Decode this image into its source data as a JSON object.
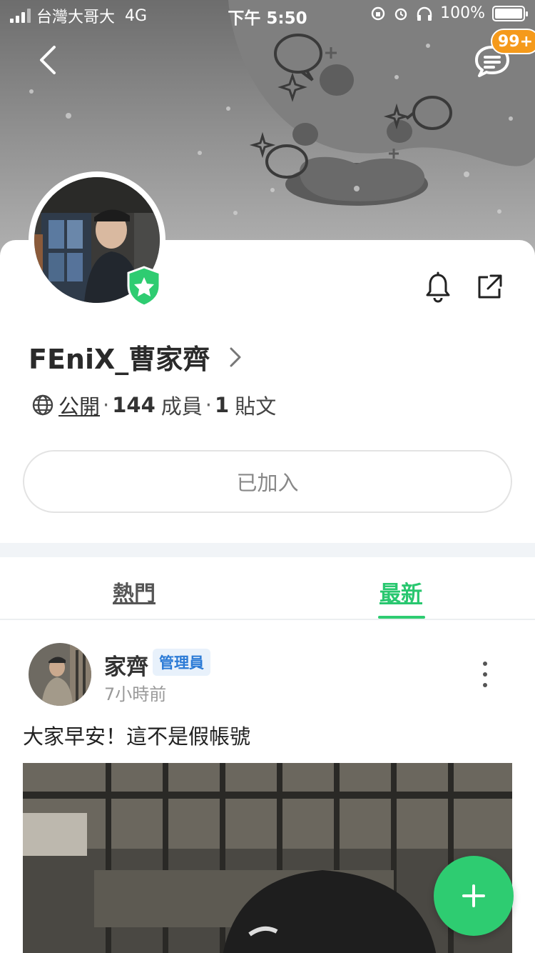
{
  "status_bar": {
    "carrier": "台灣大哥大",
    "network": "4G",
    "time": "下午 5:50",
    "battery": "100%"
  },
  "header": {
    "chat_badge": "99+"
  },
  "group": {
    "name": "FEniX_曹家齊",
    "privacy": "公開",
    "separator": "·",
    "member_count": "144",
    "member_label": "成員",
    "post_count": "1",
    "post_label": "貼文",
    "joined_label": "已加入"
  },
  "tabs": {
    "hot": "熱門",
    "latest": "最新"
  },
  "post": {
    "author": "家齊",
    "role_badge": "管理員",
    "time": "7小時前",
    "text": "大家早安！這不是假帳號"
  },
  "colors": {
    "accent": "#2ecc71",
    "badge": "#f59a1b",
    "admin_badge_text": "#2c7bd6"
  },
  "icons": [
    "back-icon",
    "chat-list-icon",
    "bell-icon",
    "share-icon",
    "globe-icon",
    "chevron-right-icon",
    "verified-shield-icon",
    "more-vertical-icon",
    "plus-icon"
  ]
}
